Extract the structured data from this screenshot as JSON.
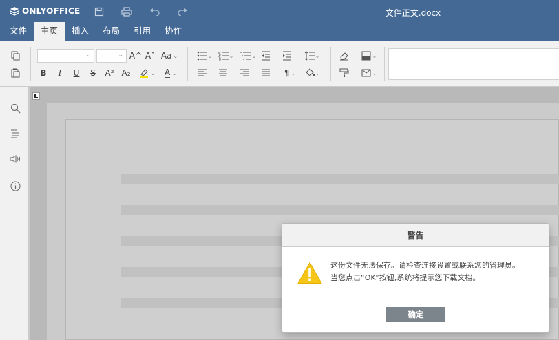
{
  "app": {
    "brand": "ONLYOFFICE",
    "document_title": "文件正文.docx"
  },
  "tabs": [
    {
      "label": "文件",
      "active": false
    },
    {
      "label": "主页",
      "active": true
    },
    {
      "label": "插入",
      "active": false
    },
    {
      "label": "布局",
      "active": false
    },
    {
      "label": "引用",
      "active": false
    },
    {
      "label": "协作",
      "active": false
    }
  ],
  "toolbar": {
    "bold": "B",
    "italic": "I",
    "underline": "U",
    "strike": "S",
    "superscript": "A²",
    "subscript": "A₂",
    "font_color": "A",
    "grow_font": "A^",
    "shrink_font": "Aˇ",
    "change_case": "Aa",
    "paragraph_mark": "¶"
  },
  "dialog": {
    "title": "警告",
    "message_line1": "这份文件无法保存。请检查连接设置或联系您的管理员。",
    "message_line2": "当您点击“OK”按钮,系统将提示您下载文档。",
    "button": "确定"
  },
  "colors": {
    "header": "#446995",
    "toolbar": "#f1f1f1",
    "warning": "#f5c518",
    "button": "#7d858c"
  }
}
